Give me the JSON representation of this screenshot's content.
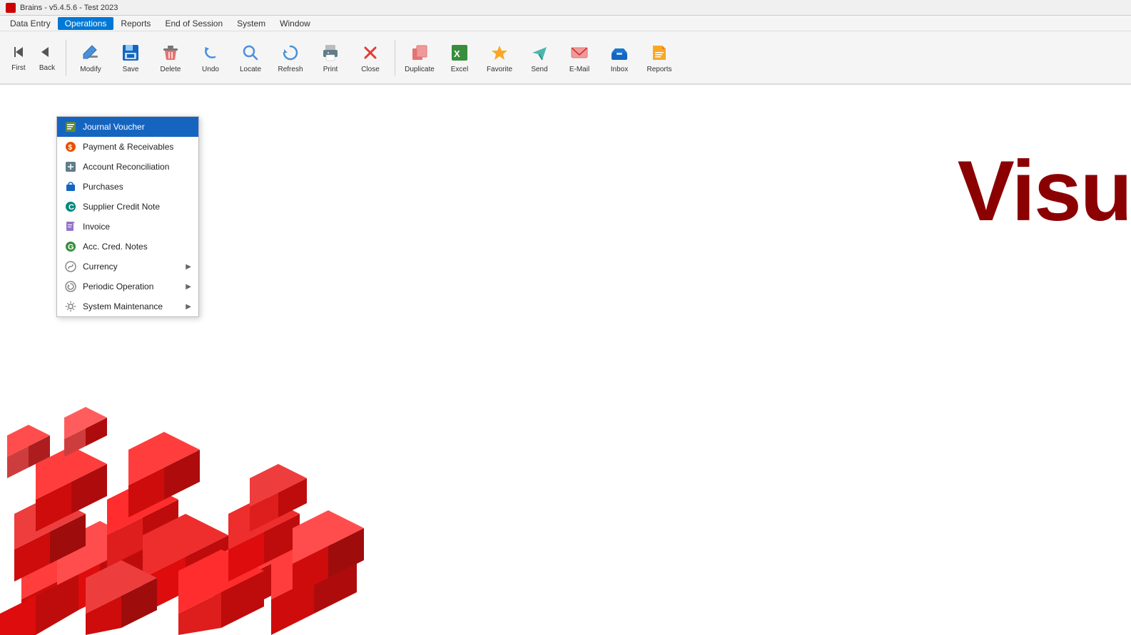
{
  "titlebar": {
    "title": "Brains - v5.4.5.6 - Test 2023",
    "icon": "app-icon"
  },
  "menubar": {
    "items": [
      {
        "id": "data-entry",
        "label": "Data Entry",
        "active": false
      },
      {
        "id": "operations",
        "label": "Operations",
        "active": true
      },
      {
        "id": "reports",
        "label": "Reports",
        "active": false
      },
      {
        "id": "end-of-session",
        "label": "End of Session",
        "active": false
      },
      {
        "id": "system",
        "label": "System",
        "active": false
      },
      {
        "id": "window",
        "label": "Window",
        "active": false
      }
    ]
  },
  "toolbar": {
    "buttons": [
      {
        "id": "first",
        "label": "First",
        "icon": "⏮"
      },
      {
        "id": "back",
        "label": "Back",
        "icon": "◀"
      },
      {
        "id": "modify",
        "label": "Modify",
        "icon": "✏️"
      },
      {
        "id": "save",
        "label": "Save",
        "icon": "💾"
      },
      {
        "id": "delete",
        "label": "Delete",
        "icon": "🗑️"
      },
      {
        "id": "undo",
        "label": "Undo",
        "icon": "↩"
      },
      {
        "id": "locate",
        "label": "Locate",
        "icon": "🔍"
      },
      {
        "id": "refresh",
        "label": "Refresh",
        "icon": "🔄"
      },
      {
        "id": "print",
        "label": "Print",
        "icon": "🖨️"
      },
      {
        "id": "close",
        "label": "Close",
        "icon": "✖"
      },
      {
        "id": "duplicate",
        "label": "Duplicate",
        "icon": "📋"
      },
      {
        "id": "excel",
        "label": "Excel",
        "icon": "📊"
      },
      {
        "id": "favorite",
        "label": "Favorite",
        "icon": "⭐"
      },
      {
        "id": "send",
        "label": "Send",
        "icon": "➤"
      },
      {
        "id": "email",
        "label": "E-Mail",
        "icon": "✉"
      },
      {
        "id": "inbox",
        "label": "Inbox",
        "icon": "📥"
      },
      {
        "id": "reports",
        "label": "Reports",
        "icon": "📁"
      }
    ]
  },
  "dropdown": {
    "items": [
      {
        "id": "journal-voucher",
        "label": "Journal Voucher",
        "icon": "journal",
        "highlighted": true,
        "hasArrow": false
      },
      {
        "id": "payment-receivables",
        "label": "Payment & Receivables",
        "icon": "payment",
        "highlighted": false,
        "hasArrow": false
      },
      {
        "id": "account-reconciliation",
        "label": "Account Reconciliation",
        "icon": "account",
        "highlighted": false,
        "hasArrow": false
      },
      {
        "id": "purchases",
        "label": "Purchases",
        "icon": "purchases",
        "highlighted": false,
        "hasArrow": false
      },
      {
        "id": "supplier-credit-note",
        "label": "Supplier Credit Note",
        "icon": "supplier",
        "highlighted": false,
        "hasArrow": false
      },
      {
        "id": "invoice",
        "label": "Invoice",
        "icon": "invoice",
        "highlighted": false,
        "hasArrow": false
      },
      {
        "id": "acc-cred-notes",
        "label": "Acc. Cred. Notes",
        "icon": "acccred",
        "highlighted": false,
        "hasArrow": false
      },
      {
        "id": "currency",
        "label": "Currency",
        "icon": "currency",
        "highlighted": false,
        "hasArrow": true
      },
      {
        "id": "periodic-operation",
        "label": "Periodic Operation",
        "icon": "periodic",
        "highlighted": false,
        "hasArrow": true
      },
      {
        "id": "system-maintenance",
        "label": "System Maintenance",
        "icon": "system",
        "highlighted": false,
        "hasArrow": true
      }
    ]
  },
  "content": {
    "visu_text": "Visu"
  },
  "colors": {
    "accent": "#8b0000",
    "highlight": "#1565c0",
    "menu_active": "#0078d7"
  }
}
